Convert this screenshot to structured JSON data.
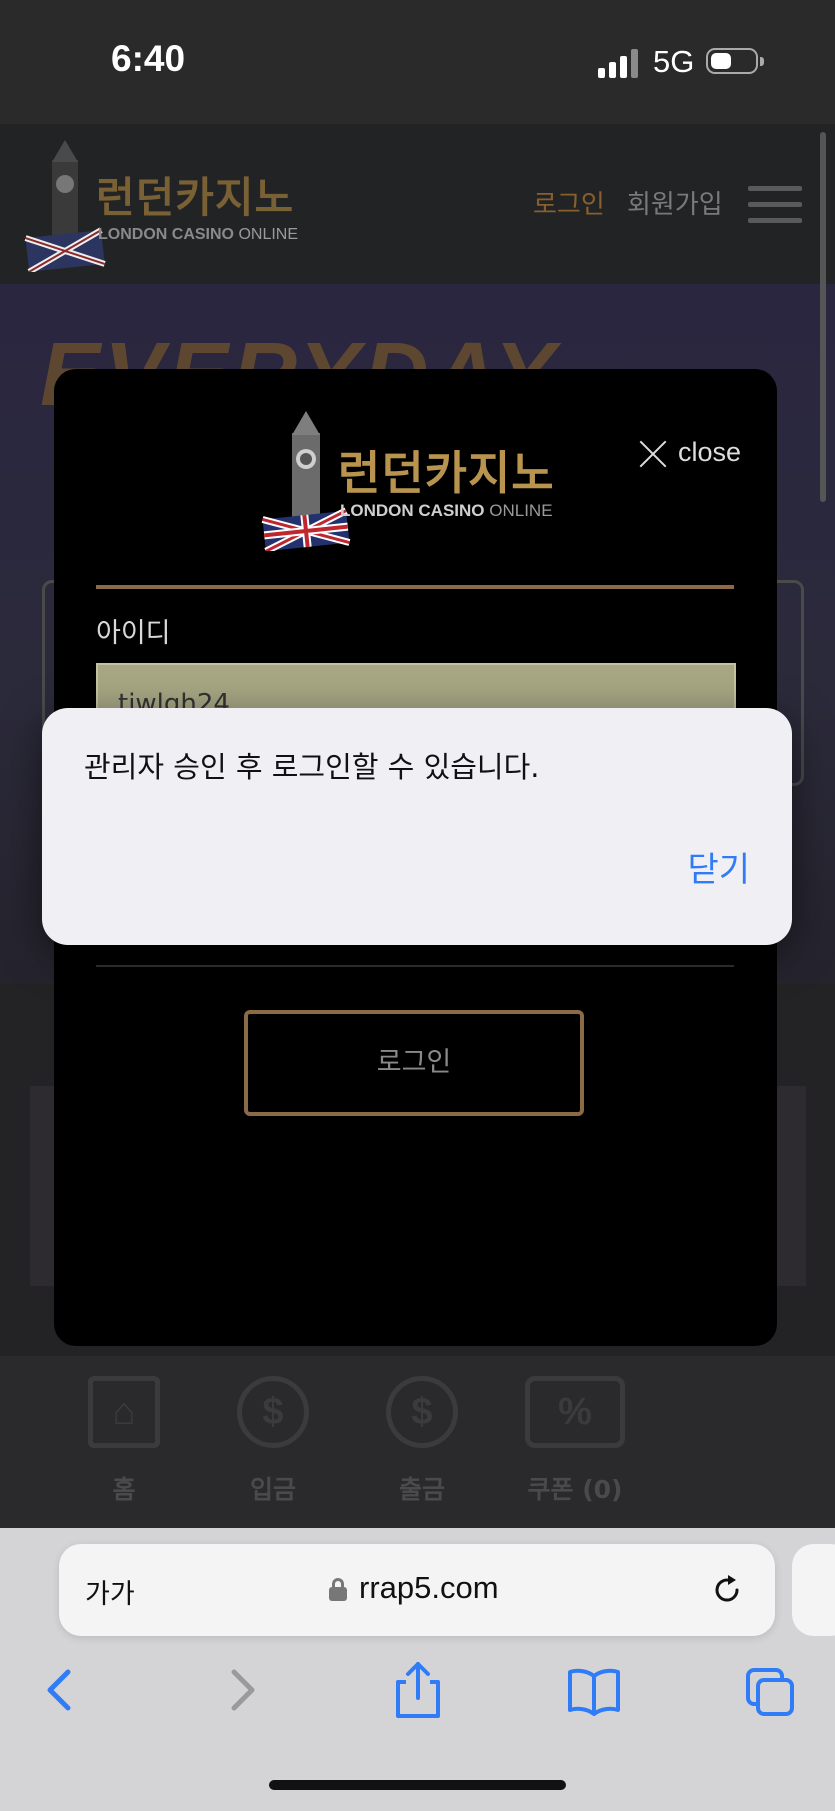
{
  "status_bar": {
    "time": "6:40",
    "network": "5G"
  },
  "site_header": {
    "logo": {
      "korean": "런던카지노",
      "english_bold": "LONDON CASINO",
      "english_light": "ONLINE"
    },
    "nav": {
      "login": "로그인",
      "signup": "회원가입"
    }
  },
  "hero": {
    "headline": "EVERYDAY"
  },
  "login_modal": {
    "close_label": "close",
    "logo": {
      "korean": "런던카지노",
      "english_bold": "LONDON CASINO",
      "english_light": "ONLINE"
    },
    "id_label": "아이디",
    "id_value": "tiwlgh24",
    "login_button": "로그인"
  },
  "alert": {
    "message": "관리자 승인 후 로그인할 수 있습니다.",
    "close_button": "닫기"
  },
  "bottom_nav": {
    "items": [
      {
        "label": "홈",
        "icon": "home-icon"
      },
      {
        "label": "입금",
        "icon": "deposit-icon"
      },
      {
        "label": "출금",
        "icon": "withdraw-icon"
      },
      {
        "label": "쿠폰 (0)",
        "icon": "coupon-icon"
      }
    ]
  },
  "browser": {
    "text_size_label": "가가",
    "domain": "rrap5.com"
  },
  "colors": {
    "gold": "#b8944e",
    "alert_link": "#2f7cf6"
  }
}
